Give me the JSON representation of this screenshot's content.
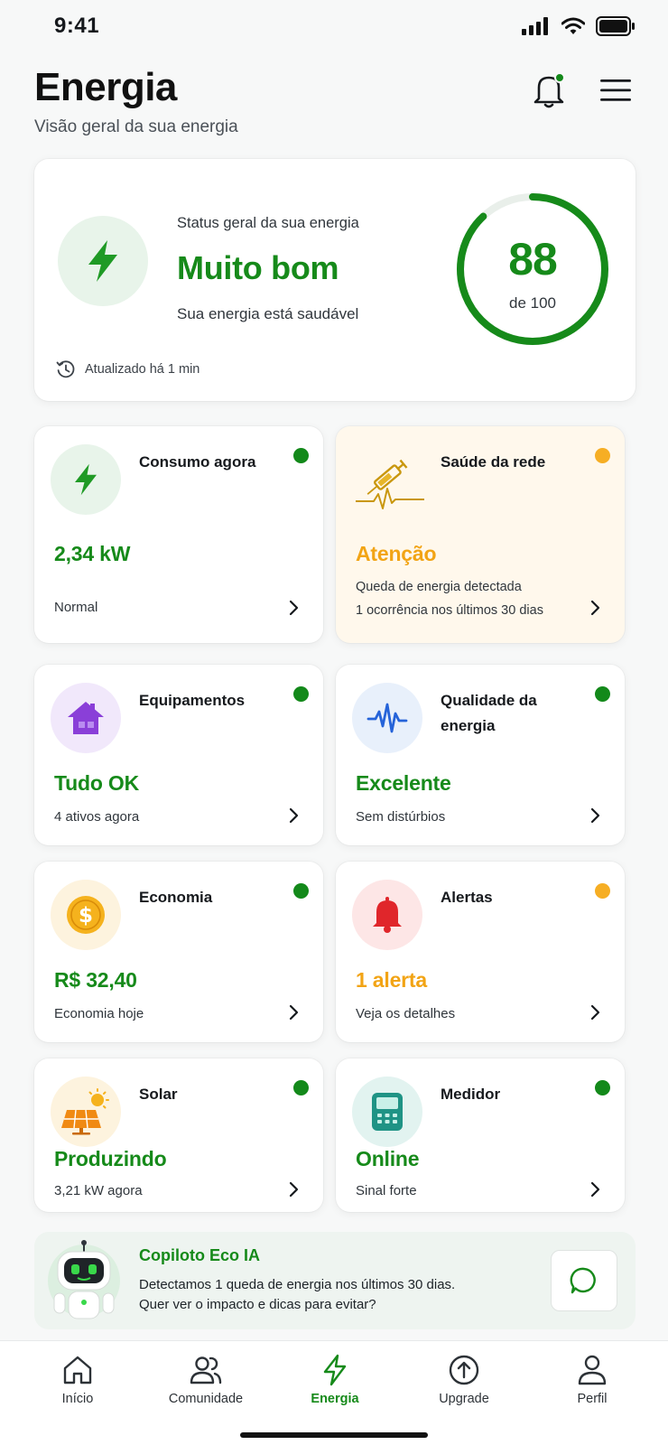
{
  "status": {
    "time": "9:41"
  },
  "header": {
    "title": "Energia",
    "subtitle": "Visão geral da sua energia"
  },
  "hero": {
    "label": "Status geral da sua energia",
    "status": "Muito bom",
    "description": "Sua energia está saudável",
    "updated": "Atualizado há 1 min",
    "score": "88",
    "score_max": "de 100",
    "score_fraction": 0.88
  },
  "tiles": [
    {
      "title": "Consumo agora",
      "value": "2,34 kW",
      "sub": "Normal",
      "status": "ok"
    },
    {
      "title": "Saúde da rede",
      "value": "Atenção",
      "sub": "Queda de energia detectada",
      "sub2": "1 ocorrência nos últimos 30 dias",
      "status": "warning"
    },
    {
      "title": "Equipamentos",
      "value": "Tudo OK",
      "sub": "4 ativos agora",
      "status": "ok"
    },
    {
      "title": "Qualidade da energia",
      "value": "Excelente",
      "sub": "Sem distúrbios",
      "status": "ok"
    },
    {
      "title": "Economia",
      "value": "R$ 32,40",
      "sub": "Economia hoje",
      "status": "ok"
    },
    {
      "title": "Alertas",
      "value": "1 alerta",
      "sub": "Veja os detalhes",
      "status": "warning"
    },
    {
      "title": "Solar",
      "value": "Produzindo",
      "sub": "3,21 kW agora",
      "status": "ok"
    },
    {
      "title": "Medidor",
      "value": "Online",
      "sub": "Sinal forte",
      "status": "ok"
    }
  ],
  "copilot": {
    "title": "Copiloto Eco IA",
    "text": "Detectamos 1 queda de energia nos últimos 30 dias. Quer ver o impacto e dicas para evitar?"
  },
  "tabs": [
    {
      "label": "Início",
      "icon": "home-icon"
    },
    {
      "label": "Comunidade",
      "icon": "community-icon"
    },
    {
      "label": "Energia",
      "icon": "energy-icon",
      "active": true
    },
    {
      "label": "Upgrade",
      "icon": "upgrade-icon"
    },
    {
      "label": "Perfil",
      "icon": "profile-icon"
    }
  ],
  "colors": {
    "green": "#168a1a",
    "amber": "#f2a415",
    "dot_green": "#13891a",
    "dot_amber": "#f6ae24"
  }
}
